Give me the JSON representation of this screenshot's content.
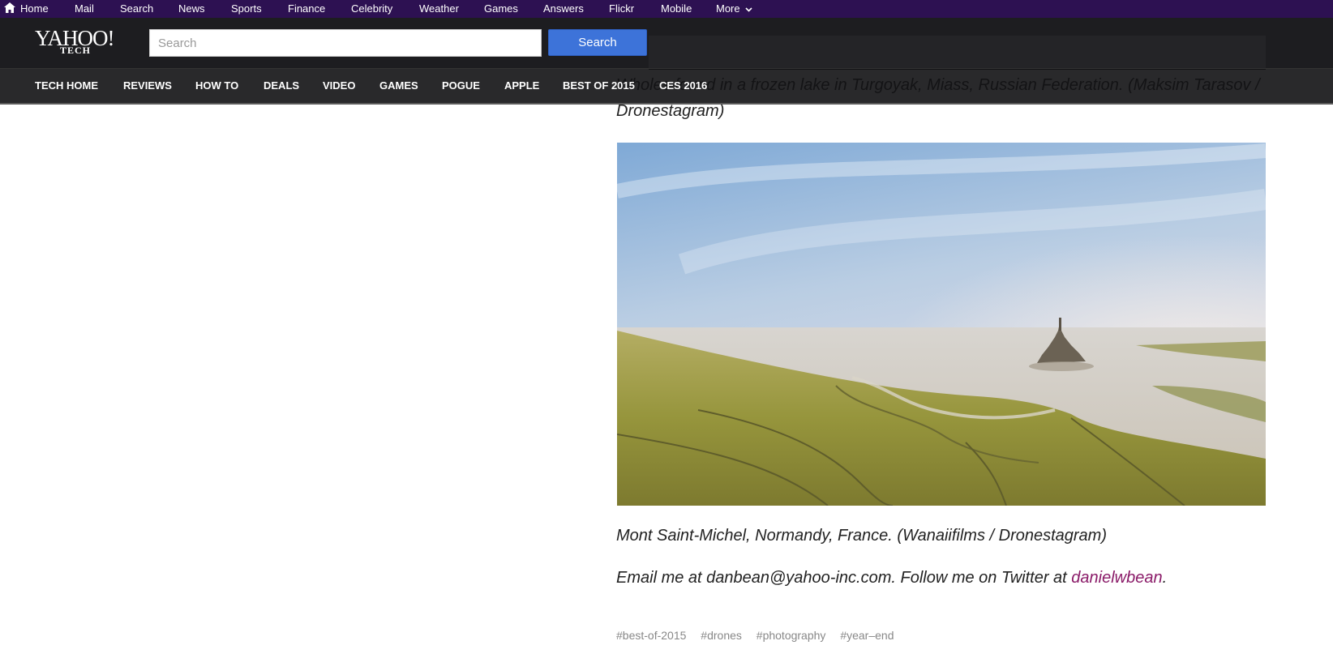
{
  "topbar": {
    "items": [
      "Home",
      "Mail",
      "Search",
      "News",
      "Sports",
      "Finance",
      "Celebrity",
      "Weather",
      "Games",
      "Answers",
      "Flickr",
      "Mobile",
      "More"
    ]
  },
  "masthead": {
    "logo": "YAHOO!",
    "logo_sub": "TECH",
    "search_placeholder": "Search",
    "search_value": "",
    "search_button": "Search"
  },
  "section_nav": {
    "items": [
      "TECH HOME",
      "REVIEWS",
      "HOW TO",
      "DEALS",
      "VIDEO",
      "GAMES",
      "POGUE",
      "APPLE",
      "BEST OF 2015",
      "CES 2016"
    ]
  },
  "article": {
    "prev_caption": "Wholes found in a frozen lake in Turgoyak, Miass, Russian Federation. (Maksim Tarasov / Dronestagram)",
    "photo_alt": "Mont Saint-Michel aerial view",
    "caption": "Mont Saint-Michel, Normandy, France. (Wanaiifilms / Dronestagram)",
    "email_prefix": "Email me at danbean@yahoo-inc.com. Follow me on Twitter at ",
    "twitter_handle": "danielwbean",
    "email_suffix": ".",
    "tags": [
      "#best-of-2015",
      "#drones",
      "#photography",
      "#year–end"
    ]
  },
  "colors": {
    "topbar_bg": "#2d1152",
    "masthead_bg": "#1d1d20",
    "search_button": "#3d73d9",
    "link": "#8a1a68"
  }
}
